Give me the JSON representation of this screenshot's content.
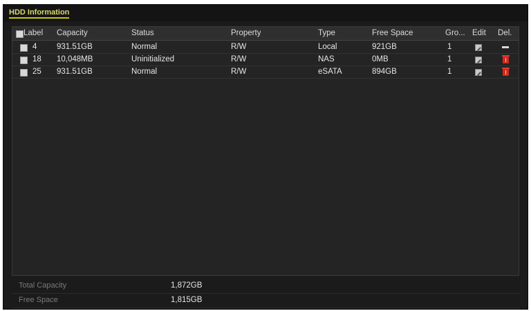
{
  "tab": {
    "title": "HDD Information"
  },
  "table": {
    "headers": {
      "label": "Label",
      "capacity": "Capacity",
      "status": "Status",
      "property": "Property",
      "type": "Type",
      "free_space": "Free Space",
      "group": "Gro...",
      "edit": "Edit",
      "delete": "Del."
    },
    "rows": [
      {
        "label": "4",
        "capacity": "931.51GB",
        "status": "Normal",
        "property": "R/W",
        "type": "Local",
        "free_space": "921GB",
        "group": "1",
        "delete_icon": "dash"
      },
      {
        "label": "18",
        "capacity": "10,048MB",
        "status": "Uninitialized",
        "property": "R/W",
        "type": "NAS",
        "free_space": "0MB",
        "group": "1",
        "delete_icon": "trash-icon"
      },
      {
        "label": "25",
        "capacity": "931.51GB",
        "status": "Normal",
        "property": "R/W",
        "type": "eSATA",
        "free_space": "894GB",
        "group": "1",
        "delete_icon": "trash-icon"
      }
    ]
  },
  "summary": {
    "total_capacity_label": "Total Capacity",
    "total_capacity_value": "1,872GB",
    "free_space_label": "Free Space",
    "free_space_value": "1,815GB"
  },
  "colors": {
    "accent": "#c8c800",
    "delete": "#d22a1e",
    "background": "#1b1b1b"
  }
}
